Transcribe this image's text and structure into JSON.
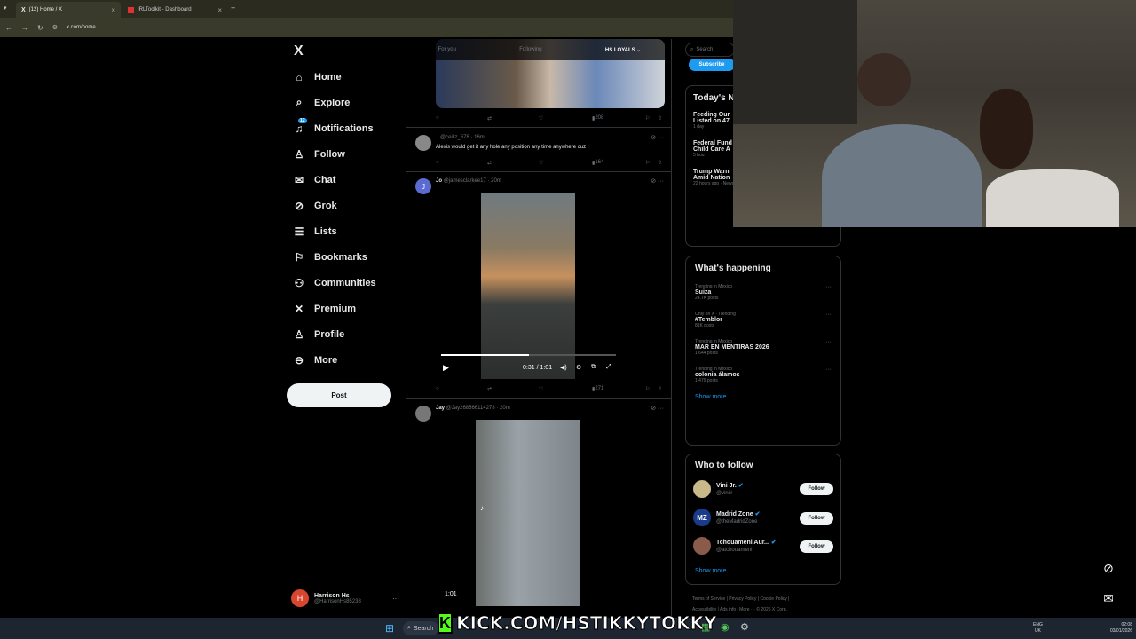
{
  "browser": {
    "tabs": [
      {
        "label": "(12) Home / X",
        "close": "×"
      },
      {
        "label": "IRLToolkit - Dashboard",
        "close": "×"
      }
    ],
    "new_tab": "+",
    "url": "x.com/home"
  },
  "nav": {
    "logo": "X",
    "items": [
      {
        "label": "Home",
        "icon": "home-icon"
      },
      {
        "label": "Explore",
        "icon": "search-icon"
      },
      {
        "label": "Notifications",
        "icon": "bell-icon",
        "badge": "12"
      },
      {
        "label": "Follow",
        "icon": "add-person-icon"
      },
      {
        "label": "Chat",
        "icon": "mail-icon"
      },
      {
        "label": "Grok",
        "icon": "grok-icon"
      },
      {
        "label": "Lists",
        "icon": "list-icon"
      },
      {
        "label": "Bookmarks",
        "icon": "bookmark-icon"
      },
      {
        "label": "Communities",
        "icon": "people-icon"
      },
      {
        "label": "Premium",
        "icon": "x-icon"
      },
      {
        "label": "Profile",
        "icon": "person-icon"
      },
      {
        "label": "More",
        "icon": "more-circle-icon"
      }
    ],
    "post_label": "Post",
    "account": {
      "name": "Harrison Hs",
      "handle": "@HarrisonHs85238",
      "initial": "H",
      "more": "···"
    }
  },
  "feed": {
    "tabs": [
      "For you",
      "Following",
      "HS LOYALS ⌄"
    ],
    "tweet1": {
      "views": "208"
    },
    "tweet2": {
      "name": "..",
      "handle": "@ceillz_678 · 16m",
      "text": "Alexis would get it any hole any position any time anywhere cuz",
      "views": "164"
    },
    "tweet3": {
      "name": "Jo",
      "handle": "@jamesclarkee17 · 20m",
      "video_time": "0:31 / 1:01",
      "views": "271",
      "avatar_letter": "J"
    },
    "tweet4": {
      "name": "Jay",
      "handle": "@Jay268566114278 · 20m",
      "video_time": "1:01"
    }
  },
  "right": {
    "search_placeholder": "Search",
    "subscribe": "Subscribe",
    "news": {
      "title": "Today's N",
      "items": [
        {
          "headline1": "Feeding Our",
          "headline2": "Listed on 47",
          "meta": "1 day"
        },
        {
          "headline1": "Federal Fund",
          "headline2": "Child Care A",
          "meta": "5 hou"
        },
        {
          "headline1": "Trump Warn",
          "headline2": "Amid Nation",
          "meta": "22 hours ago · News · 1M posts"
        }
      ]
    },
    "happening": {
      "title": "What's happening",
      "trends": [
        {
          "meta": "Trending in Mexico",
          "name": "Suiza",
          "count": "24.7K posts"
        },
        {
          "meta": "Only on X · Trending",
          "name": "#Temblor",
          "count": "81K posts"
        },
        {
          "meta": "Trending in Mexico",
          "name": "MAR EN MENTIRAS 2026",
          "count": "1,644 posts"
        },
        {
          "meta": "Trending in Mexico",
          "name": "colonia álamos",
          "count": "1,479 posts"
        }
      ],
      "show_more": "Show more"
    },
    "who_to_follow": {
      "title": "Who to follow",
      "people": [
        {
          "name": "Vini Jr.",
          "handle": "@vinijr",
          "button": "Follow"
        },
        {
          "name": "Madrid Zone",
          "handle": "@theMadridZone",
          "button": "Follow",
          "avatar_text": "MZ"
        },
        {
          "name": "Tchouameni Aur...",
          "handle": "@atchouameni",
          "button": "Follow"
        }
      ],
      "show_more": "Show more"
    },
    "footer": {
      "line1": "Terms of Service | Privacy Policy | Cookie Policy |",
      "line2": "Accessibility | Ads info | More ··· © 2026 X Corp."
    }
  },
  "overlay": {
    "kick_logo": "K",
    "kick_text": "KICK.COM/HSTIKKYTOKKY"
  },
  "taskbar": {
    "search": "Search",
    "lang1": "ENG",
    "lang2": "UK",
    "time": "02:08",
    "date": "03/01/2026"
  },
  "colors": {
    "accent": "#1d9bf0",
    "kick_green": "#53fc18",
    "border": "#2f3336"
  }
}
